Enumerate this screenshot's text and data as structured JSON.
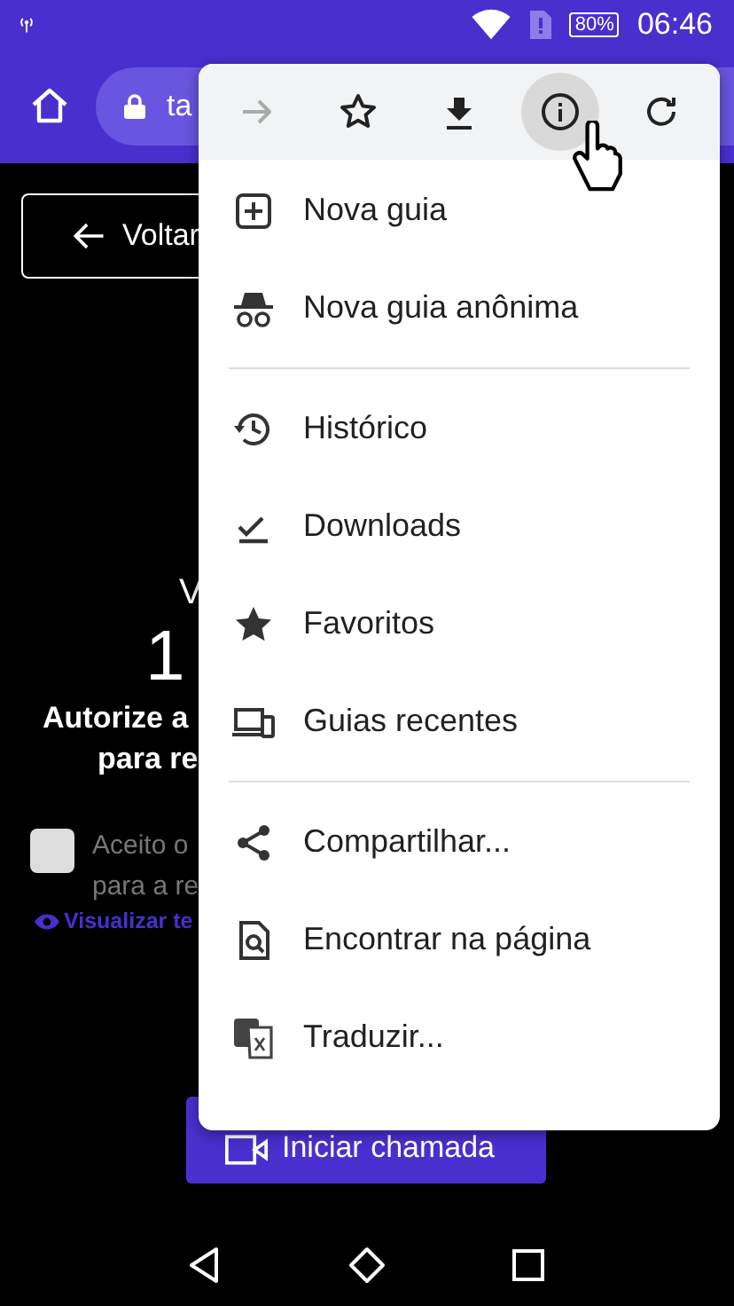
{
  "status_bar": {
    "battery": "80%",
    "time": "06:46"
  },
  "browser_toolbar": {
    "url": "ta"
  },
  "page": {
    "back_button": "Voltar",
    "line_1": "V",
    "line_2": "1",
    "heading_lines": [
      "Autorize a",
      "para re"
    ],
    "consent": {
      "checked": false,
      "lines": [
        "Aceito o",
        "para a re"
      ]
    },
    "terms_link": "Visualizar te",
    "call_button": "Iniciar chamada"
  },
  "menu": {
    "actions": [
      {
        "disabled": true,
        "selected": false
      },
      {
        "disabled": false,
        "selected": false
      },
      {
        "disabled": false,
        "selected": false
      },
      {
        "disabled": false,
        "selected": true
      },
      {
        "disabled": false,
        "selected": false
      }
    ],
    "items": [
      {
        "kind": "item",
        "label": "Nova guia"
      },
      {
        "kind": "item",
        "label": "Nova guia anônima"
      },
      {
        "kind": "divider"
      },
      {
        "kind": "item",
        "label": "Histórico"
      },
      {
        "kind": "item",
        "label": "Downloads"
      },
      {
        "kind": "item",
        "label": "Favoritos"
      },
      {
        "kind": "item",
        "label": "Guias recentes"
      },
      {
        "kind": "divider"
      },
      {
        "kind": "item",
        "label": "Compartilhar..."
      },
      {
        "kind": "item",
        "label": "Encontrar na página"
      },
      {
        "kind": "item",
        "label": "Traduzir..."
      }
    ]
  }
}
